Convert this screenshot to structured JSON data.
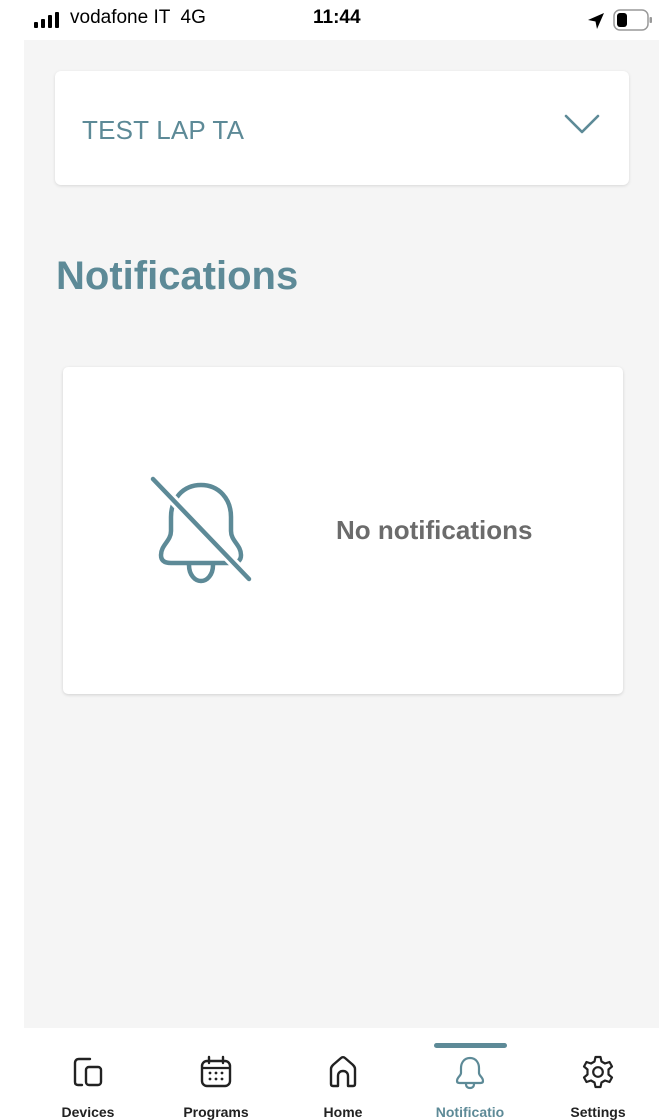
{
  "status_bar": {
    "carrier": "vodafone IT  4G",
    "time": "11:44"
  },
  "device_selector": {
    "name": "TEST LAP TA",
    "icon": "chevron-down-icon"
  },
  "page": {
    "title": "Notifications"
  },
  "empty_state": {
    "icon": "bell-off-icon",
    "text": "No notifications"
  },
  "tab_bar": {
    "active_tab": "notifications",
    "accent_color": "#5d8a97",
    "tabs": [
      {
        "id": "devices",
        "label": "Devices",
        "icon": "devices-icon"
      },
      {
        "id": "programs",
        "label": "Programs",
        "icon": "calendar-icon"
      },
      {
        "id": "home",
        "label": "Home",
        "icon": "home-icon"
      },
      {
        "id": "notifications",
        "label": "Notificatio",
        "icon": "bell-icon"
      },
      {
        "id": "settings",
        "label": "Settings",
        "icon": "gear-icon"
      }
    ]
  }
}
